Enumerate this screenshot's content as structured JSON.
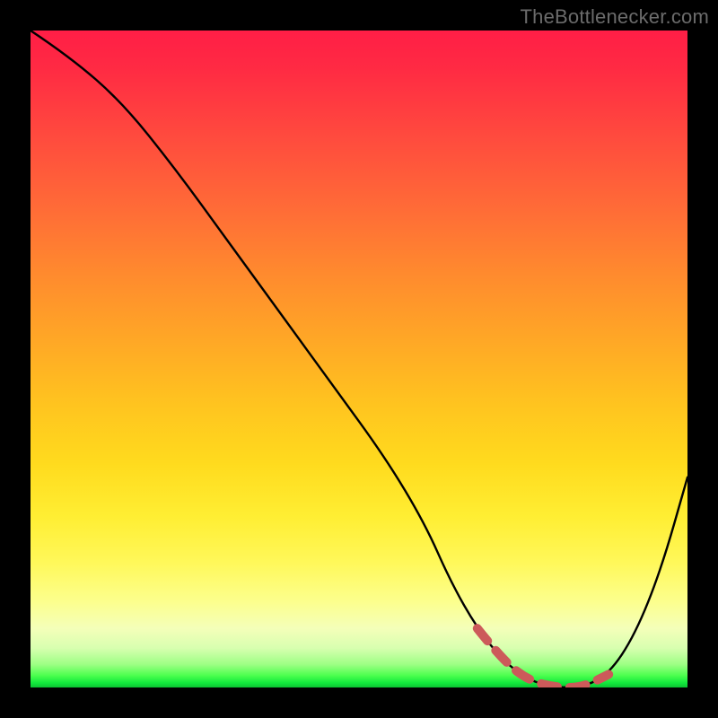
{
  "watermark": "TheBottlenecker.com",
  "chart_data": {
    "type": "line",
    "title": "",
    "xlabel": "",
    "ylabel": "",
    "xlim": [
      0,
      100
    ],
    "ylim": [
      0,
      100
    ],
    "series": [
      {
        "name": "bottleneck-curve",
        "x": [
          0,
          6,
          14,
          22,
          30,
          38,
          46,
          54,
          60,
          64,
          68,
          72,
          76,
          80,
          84,
          88,
          92,
          96,
          100
        ],
        "values": [
          100,
          96,
          89,
          79,
          68,
          57,
          46,
          35,
          25,
          16,
          9,
          4,
          1,
          0,
          0,
          2,
          8,
          18,
          32
        ]
      }
    ],
    "annotations": [
      {
        "name": "flat-bottom-highlight",
        "x_range": [
          67,
          88
        ],
        "style": "red-dashes"
      }
    ],
    "background_gradient_meaning": "heatmap from red (high bottleneck) at top to green (no bottleneck) at bottom"
  }
}
